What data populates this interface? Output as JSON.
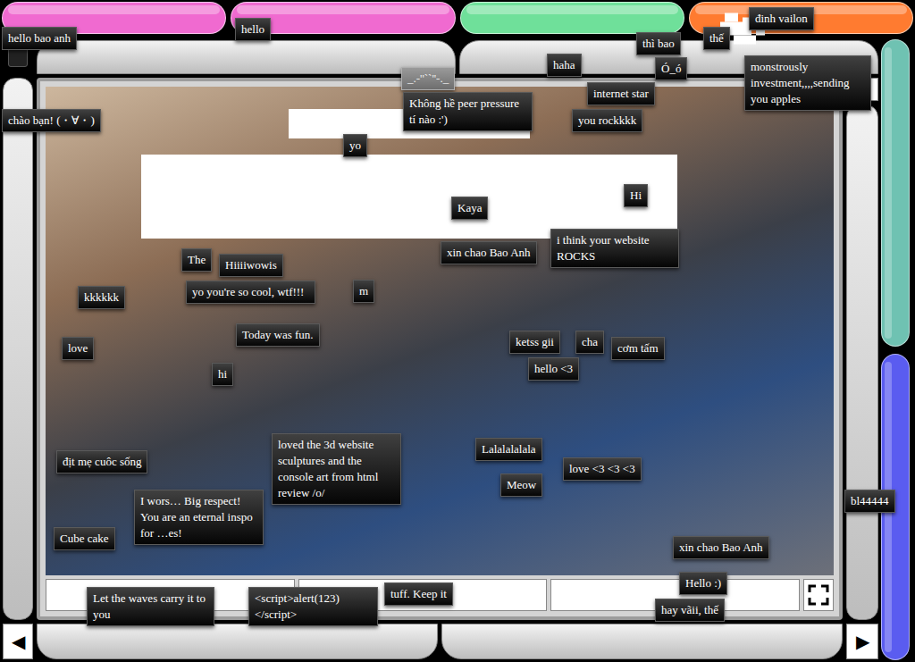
{
  "top_bar": {
    "segments": [
      {
        "color": "#f06ad0"
      },
      {
        "color": "#f06ad0"
      },
      {
        "color": "#6fe09a"
      },
      {
        "color": "#ff7b30"
      }
    ]
  },
  "side_bars": [
    {
      "color": "#6fc2b2"
    },
    {
      "color": "#5a5cf0"
    }
  ],
  "navigation": {
    "previous": "◀",
    "next": "▶"
  },
  "message_fields": [
    {
      "value": ""
    },
    {
      "value": ""
    },
    {
      "value": ""
    }
  ],
  "notes": [
    {
      "text": "hello bao anh",
      "kind": "note"
    },
    {
      "text": "hello",
      "kind": "note"
    },
    {
      "text": "thế",
      "kind": "note"
    },
    {
      "text": "đinh vailon",
      "kind": "note"
    },
    {
      "text": "thì bao",
      "kind": "note"
    },
    {
      "text": "Ó_ó",
      "kind": "note"
    },
    {
      "text": "haha",
      "kind": "note"
    },
    {
      "text": "monstrously investment,,,,sending you apples",
      "kind": "note"
    },
    {
      "text": "chào bạn! (・∀・)",
      "kind": "note"
    },
    {
      "text": "_.-''``''-._",
      "kind": "faded"
    },
    {
      "text": "Không hề peer pressure tí nào :')",
      "kind": "note"
    },
    {
      "text": "internet star",
      "kind": "note"
    },
    {
      "text": "you rockkkk",
      "kind": "note"
    },
    {
      "text": "yo",
      "kind": "note"
    },
    {
      "text": "Kaya",
      "kind": "note"
    },
    {
      "text": "Hi",
      "kind": "note"
    },
    {
      "text": "xin chao Bao Anh",
      "kind": "note"
    },
    {
      "text": "i think your website ROCKS",
      "kind": "note"
    },
    {
      "text": "The",
      "kind": "note"
    },
    {
      "text": "Hiiiiwowis",
      "kind": "note"
    },
    {
      "text": "yo you're so cool, wtf!!!",
      "kind": "note"
    },
    {
      "text": "m",
      "kind": "note"
    },
    {
      "text": "kkkkkk",
      "kind": "note"
    },
    {
      "text": "Today was fun.",
      "kind": "note"
    },
    {
      "text": "love",
      "kind": "note"
    },
    {
      "text": "ketss gii",
      "kind": "note"
    },
    {
      "text": "cha",
      "kind": "note"
    },
    {
      "text": "cơm tấm",
      "kind": "note"
    },
    {
      "text": "hello <3",
      "kind": "note"
    },
    {
      "text": "hi",
      "kind": "note"
    },
    {
      "text": "địt mẹ cuôc sống",
      "kind": "note"
    },
    {
      "text": "loved the 3d website sculptures and the console art from html review /o/",
      "kind": "note"
    },
    {
      "text": "Lalalalalala",
      "kind": "note"
    },
    {
      "text": "love <3 <3 <3",
      "kind": "note"
    },
    {
      "text": "Meow",
      "kind": "note"
    },
    {
      "text": "I wors… Big respect! You are an eternal inspo for …es!",
      "kind": "note"
    },
    {
      "text": "Cube cake",
      "kind": "note"
    },
    {
      "text": "bl44444",
      "kind": "note"
    },
    {
      "text": "xin chao Bao Anh",
      "kind": "note"
    },
    {
      "text": "Let the waves carry it to you",
      "kind": "note"
    },
    {
      "text": "<script>alert(123)</script>",
      "kind": "note"
    },
    {
      "text": "tuff. Keep it",
      "kind": "note"
    },
    {
      "text": "Hello :)",
      "kind": "note"
    },
    {
      "text": "hay vãii, thế",
      "kind": "note"
    }
  ]
}
